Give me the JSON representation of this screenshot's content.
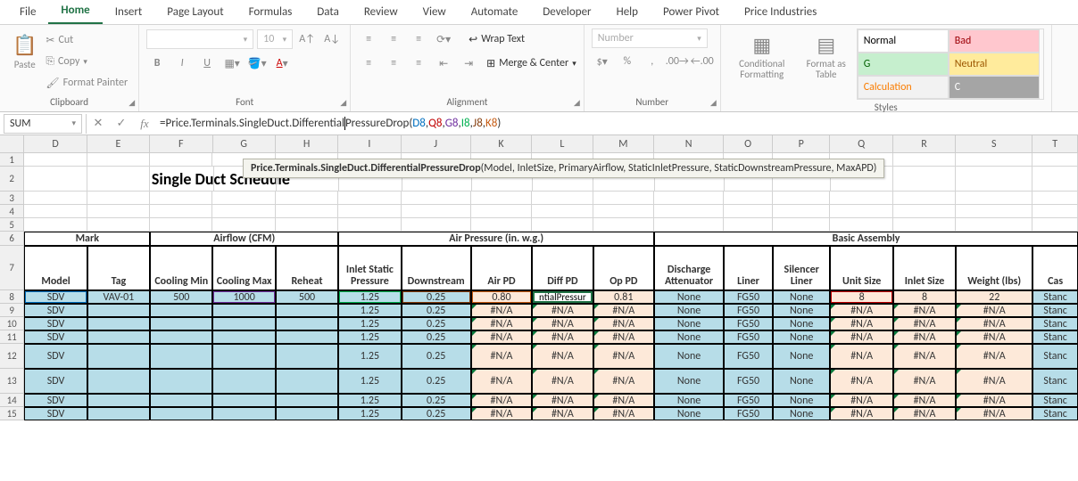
{
  "ribbon": {
    "tabs": [
      "File",
      "Home",
      "Insert",
      "Page Layout",
      "Formulas",
      "Data",
      "Review",
      "View",
      "Automate",
      "Developer",
      "Help",
      "Power Pivot",
      "Price Industries"
    ],
    "active_tab": "Home",
    "clipboard": {
      "label": "Clipboard",
      "paste": "Paste",
      "cut": "Cut",
      "copy": "Copy",
      "fp": "Format Painter"
    },
    "font": {
      "label": "Font",
      "size": "10",
      "b": "B",
      "i": "I",
      "u": "U"
    },
    "alignment": {
      "label": "Alignment",
      "wrap": "Wrap Text",
      "merge": "Merge & Center"
    },
    "number": {
      "label": "Number",
      "format": "Number"
    },
    "styles": {
      "label": "Styles",
      "cond": "Conditional Formatting",
      "table": "Format as Table",
      "gallery": [
        {
          "t": "Normal",
          "bg": "#fff",
          "c": "#000"
        },
        {
          "t": "Bad",
          "bg": "#ffc7ce",
          "c": "#9c0006"
        },
        {
          "t": "G",
          "bg": "#c6efce",
          "c": "#006100"
        },
        {
          "t": "Neutral",
          "bg": "#ffeb9c",
          "c": "#9c5700"
        },
        {
          "t": "Calculation",
          "bg": "#f2f2f2",
          "c": "#fa7d00"
        },
        {
          "t": "C",
          "bg": "#a5a5a5",
          "c": "#fff"
        }
      ]
    }
  },
  "formula_bar": {
    "name_box": "SUM",
    "prefix": "=Price.Terminals.SingleDuct.Differential",
    "mid": "PressureDrop(",
    "args": [
      "D8",
      "Q8",
      "G8",
      "I8",
      "J8",
      "K8"
    ],
    "suffix": ")",
    "tooltip_fn": "Price.Terminals.SingleDuct.DifferentialPressureDrop",
    "tooltip_params": "(Model, InletSize, PrimaryAirflow, StaticInletPressure, StaticDownstreamPressure, MaxAPD)"
  },
  "sheet": {
    "title": "Single Duct Schedule",
    "col_letters": [
      "D",
      "E",
      "F",
      "G",
      "H",
      "I",
      "J",
      "K",
      "L",
      "M",
      "N",
      "O",
      "P",
      "Q",
      "R",
      "S",
      "T"
    ],
    "group_headers": {
      "mark": "Mark",
      "airflow": "Airflow (CFM)",
      "pressure": "Air Pressure (in. w.g.)",
      "assembly": "Basic Assembly"
    },
    "sub_headers": [
      "Model",
      "Tag",
      "Cooling Min",
      "Cooling Max",
      "Reheat",
      "Inlet Static Pressure",
      "Downstream",
      "Air PD",
      "Diff PD",
      "Op PD",
      "Discharge Attenuator",
      "Liner",
      "Silencer Liner",
      "Unit Size",
      "Inlet Size",
      "Weight (lbs)",
      "Cas"
    ],
    "rows": [
      {
        "n": 8,
        "v": [
          "SDV",
          "VAV-01",
          "500",
          "1000",
          "500",
          "1.25",
          "0.25",
          "0.80",
          "ntialPressur",
          "0.81",
          "None",
          "FG50",
          "None",
          "8",
          "8",
          "22",
          "Stanc"
        ],
        "edit": true
      },
      {
        "n": 9,
        "v": [
          "SDV",
          "",
          "",
          "",
          "",
          "1.25",
          "0.25",
          "#N/A",
          "#N/A",
          "#N/A",
          "None",
          "FG50",
          "None",
          "#N/A",
          "#N/A",
          "#N/A",
          "Stanc"
        ]
      },
      {
        "n": 10,
        "v": [
          "SDV",
          "",
          "",
          "",
          "",
          "1.25",
          "0.25",
          "#N/A",
          "#N/A",
          "#N/A",
          "None",
          "FG50",
          "None",
          "#N/A",
          "#N/A",
          "#N/A",
          "Stanc"
        ]
      },
      {
        "n": 11,
        "v": [
          "SDV",
          "",
          "",
          "",
          "",
          "1.25",
          "0.25",
          "#N/A",
          "#N/A",
          "#N/A",
          "None",
          "FG50",
          "None",
          "#N/A",
          "#N/A",
          "#N/A",
          "Stanc"
        ]
      },
      {
        "n": 12,
        "v": [
          "SDV",
          "",
          "",
          "",
          "",
          "1.25",
          "0.25",
          "#N/A",
          "#N/A",
          "#N/A",
          "None",
          "FG50",
          "None",
          "#N/A",
          "#N/A",
          "#N/A",
          "Stanc"
        ],
        "tall": true
      },
      {
        "n": 13,
        "v": [
          "SDV",
          "",
          "",
          "",
          "",
          "1.25",
          "0.25",
          "#N/A",
          "#N/A",
          "#N/A",
          "None",
          "FG50",
          "None",
          "#N/A",
          "#N/A",
          "#N/A",
          "Stanc"
        ],
        "tall": true
      },
      {
        "n": 14,
        "v": [
          "SDV",
          "",
          "",
          "",
          "",
          "1.25",
          "0.25",
          "#N/A",
          "#N/A",
          "#N/A",
          "None",
          "FG50",
          "None",
          "#N/A",
          "#N/A",
          "#N/A",
          "Stanc"
        ]
      },
      {
        "n": 15,
        "v": [
          "SDV",
          "",
          "",
          "",
          "",
          "1.25",
          "0.25",
          "#N/A",
          "#N/A",
          "#N/A",
          "None",
          "FG50",
          "None",
          "#N/A",
          "#N/A",
          "#N/A",
          "Stanc"
        ]
      }
    ]
  }
}
